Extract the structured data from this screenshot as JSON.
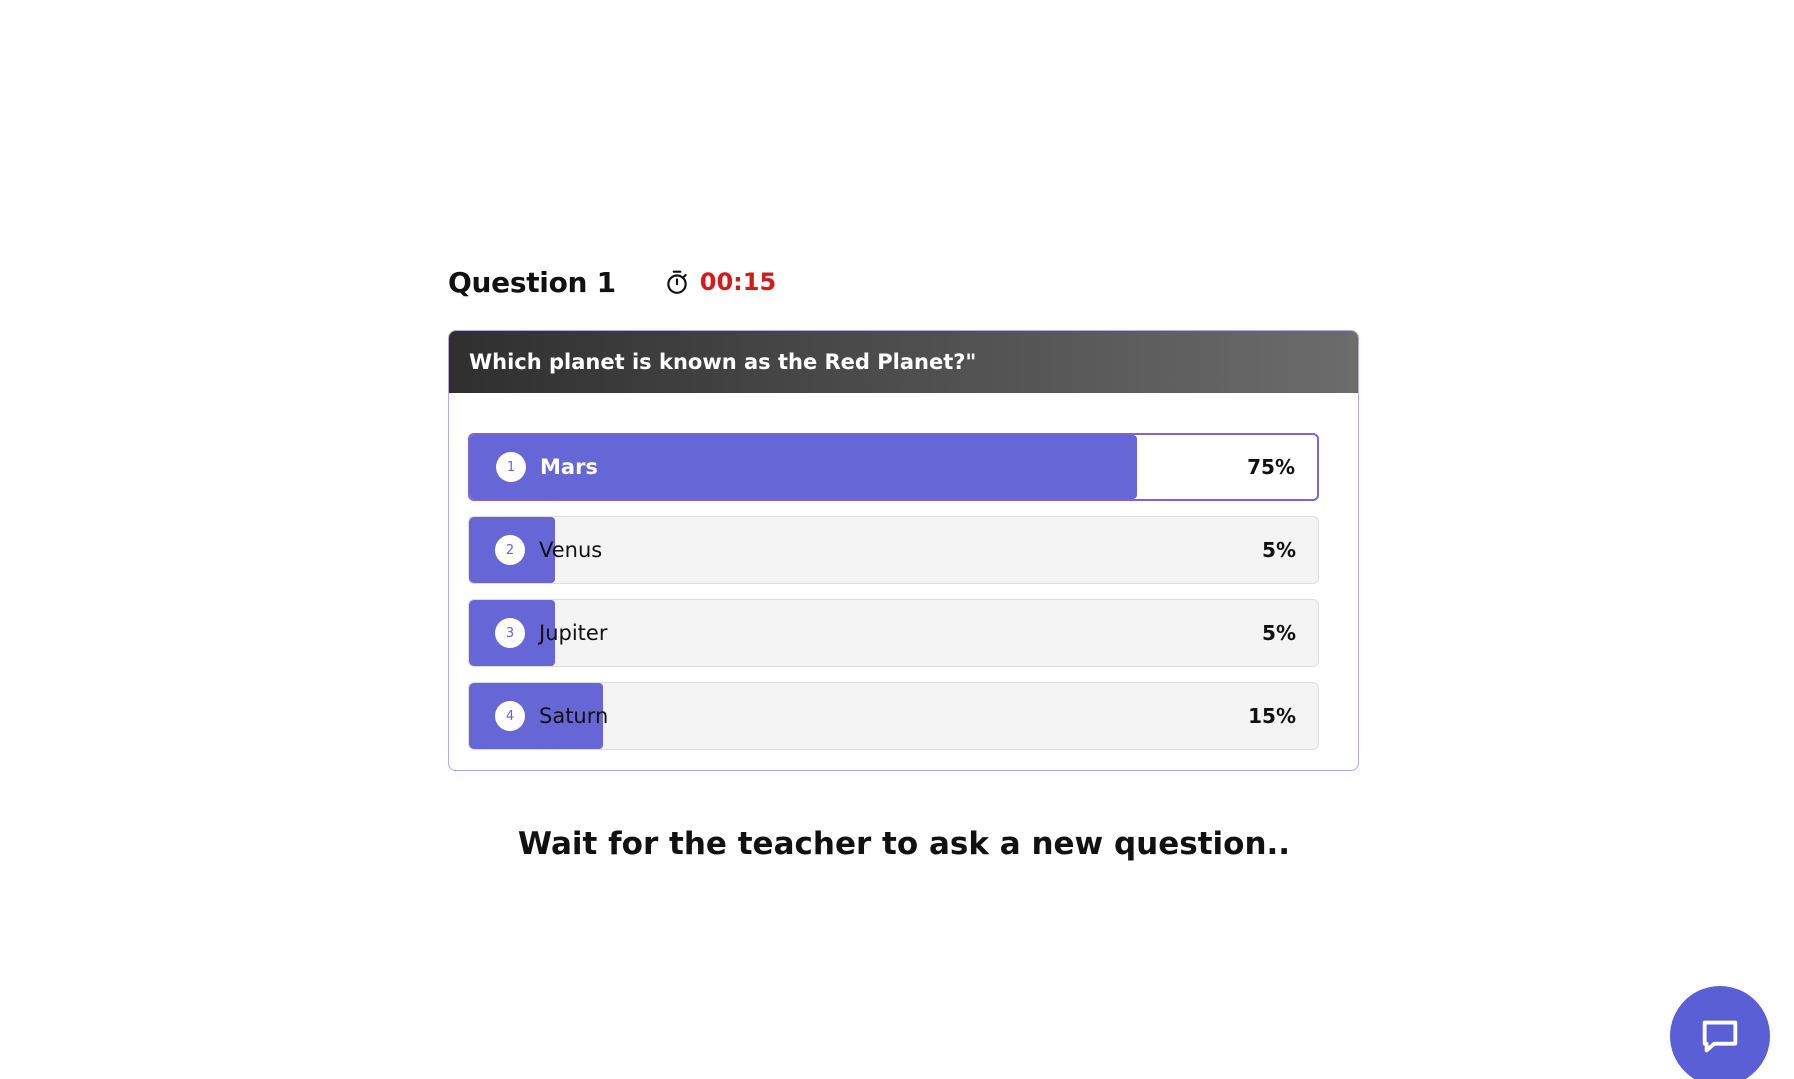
{
  "quiz": {
    "question_label": "Question 1",
    "timer": {
      "icon": "stopwatch-icon",
      "value": "00:15",
      "color": "#d41a1a"
    },
    "question_text": "Which planet is known as the Red Planet?\"",
    "options": [
      {
        "number": "1",
        "label": "Mars",
        "percent_label": "75%",
        "share": 75,
        "selected": true
      },
      {
        "number": "2",
        "label": "Venus",
        "percent_label": "5%",
        "share": 5,
        "selected": false
      },
      {
        "number": "3",
        "label": "Jupiter",
        "percent_label": "5%",
        "share": 5,
        "selected": false
      },
      {
        "number": "4",
        "label": "Saturn",
        "percent_label": "15%",
        "share": 15,
        "selected": false
      }
    ]
  },
  "status": {
    "wait_message": "Wait for the teacher to ask a new question.."
  },
  "chat": {
    "icon": "chat-bubble-icon"
  },
  "colors": {
    "accent": "#6766d6",
    "selected_border": "#7e63d6",
    "card_border": "#b9a6e3",
    "timer": "#d41a1a"
  }
}
